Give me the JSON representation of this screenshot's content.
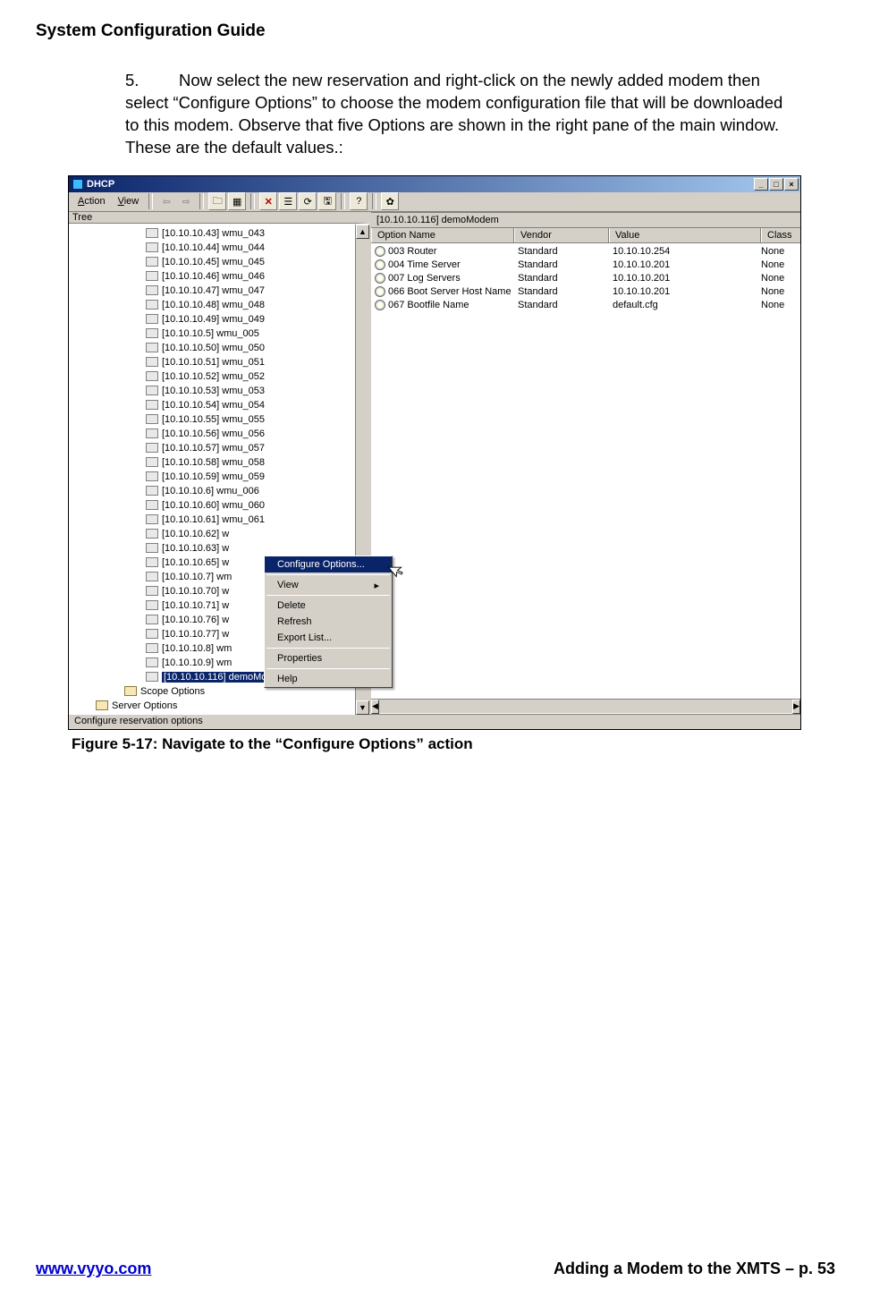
{
  "doc": {
    "title": "System Configuration Guide",
    "instruction_num": "5.",
    "instruction_text": "Now select the new reservation and right-click on the newly added modem then select “Configure Options” to choose the modem configuration file that will be downloaded to this modem.  Observe that five Options are shown in the right pane of the main window.  These are the default values.:",
    "figure_caption": "Figure 5-17: Navigate to the “Configure Options” action",
    "footer_left": "www.vyyo.com",
    "footer_right": "Adding a Modem to the XMTS – p. 53"
  },
  "app": {
    "title": "DHCP",
    "menubar": {
      "action": "Action",
      "view": "View"
    },
    "tree_header": "Tree",
    "path_header": "[10.10.10.116] demoModem",
    "status_text": "Configure reservation options",
    "columns": {
      "option": "Option Name",
      "vendor": "Vendor",
      "value": "Value",
      "class": "Class"
    },
    "options": [
      {
        "name": "003 Router",
        "vendor": "Standard",
        "value": "10.10.10.254",
        "class": "None"
      },
      {
        "name": "004 Time Server",
        "vendor": "Standard",
        "value": "10.10.10.201",
        "class": "None"
      },
      {
        "name": "007 Log Servers",
        "vendor": "Standard",
        "value": "10.10.10.201",
        "class": "None"
      },
      {
        "name": "066 Boot Server Host Name",
        "vendor": "Standard",
        "value": "10.10.10.201",
        "class": "None"
      },
      {
        "name": "067 Bootfile Name",
        "vendor": "Standard",
        "value": "default.cfg",
        "class": "None"
      }
    ],
    "context_menu": {
      "configure": "Configure Options...",
      "view": "View",
      "delete": "Delete",
      "refresh": "Refresh",
      "export": "Export List...",
      "properties": "Properties",
      "help": "Help"
    },
    "tree": {
      "items": [
        "[10.10.10.43] wmu_043",
        "[10.10.10.44] wmu_044",
        "[10.10.10.45] wmu_045",
        "[10.10.10.46] wmu_046",
        "[10.10.10.47] wmu_047",
        "[10.10.10.48] wmu_048",
        "[10.10.10.49] wmu_049",
        "[10.10.10.5] wmu_005",
        "[10.10.10.50] wmu_050",
        "[10.10.10.51] wmu_051",
        "[10.10.10.52] wmu_052",
        "[10.10.10.53] wmu_053",
        "[10.10.10.54] wmu_054",
        "[10.10.10.55] wmu_055",
        "[10.10.10.56] wmu_056",
        "[10.10.10.57] wmu_057",
        "[10.10.10.58] wmu_058",
        "[10.10.10.59] wmu_059",
        "[10.10.10.6] wmu_006",
        "[10.10.10.60] wmu_060",
        "[10.10.10.61] wmu_061",
        "[10.10.10.62] w",
        "[10.10.10.63] w",
        "[10.10.10.65] w",
        "[10.10.10.7] wm",
        "[10.10.10.70] w",
        "[10.10.10.71] w",
        "[10.10.10.76] w",
        "[10.10.10.77] w",
        "[10.10.10.8] wm",
        "[10.10.10.9] wm"
      ],
      "selected": "[10.10.10.116] demoModem",
      "scope": "Scope Options",
      "server": "Server Options"
    }
  }
}
